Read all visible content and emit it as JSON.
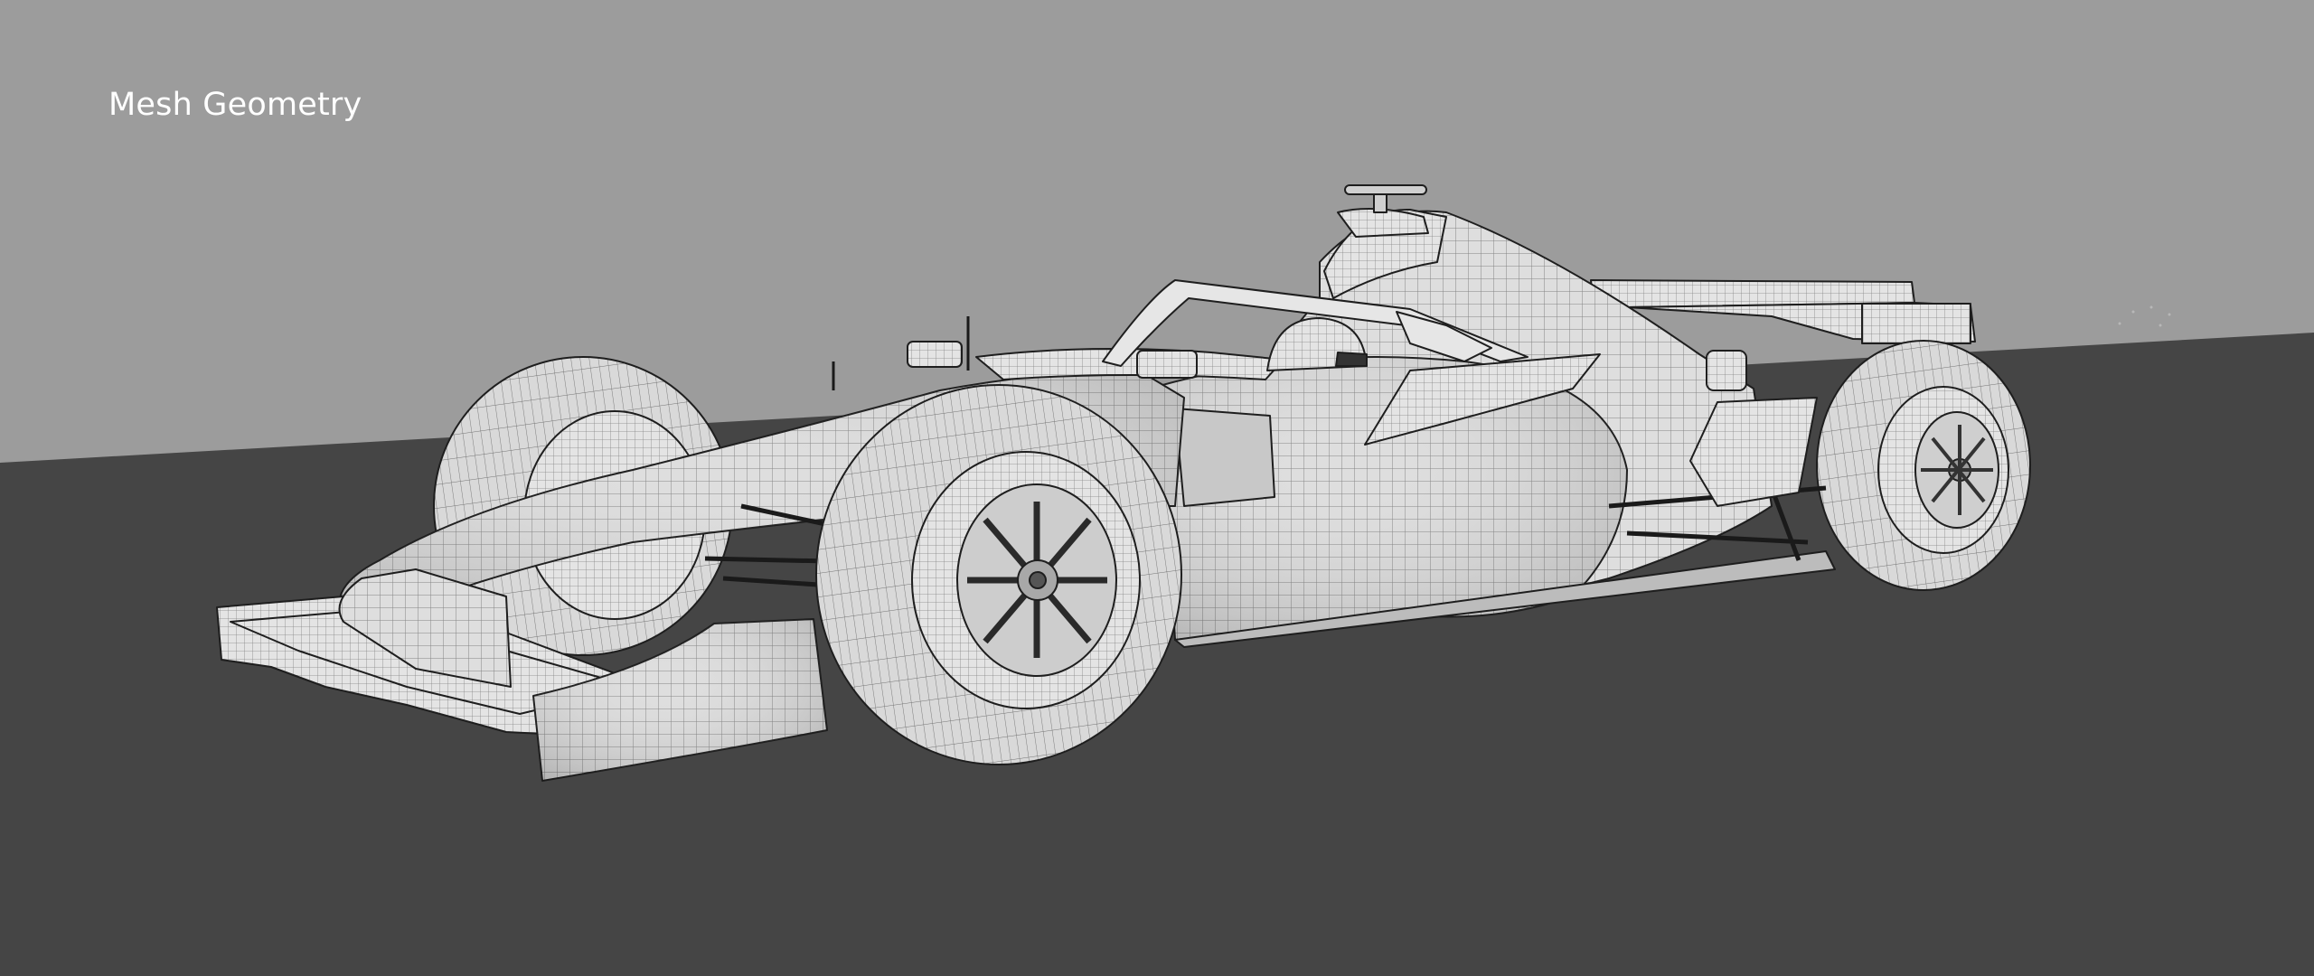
{
  "viewport": {
    "label": "Mesh Geometry",
    "background_color": "#9c9c9c",
    "floor_color": "#454545",
    "mesh_fill_color": "#dcdcdc",
    "wire_color": "#2a2a2a"
  }
}
